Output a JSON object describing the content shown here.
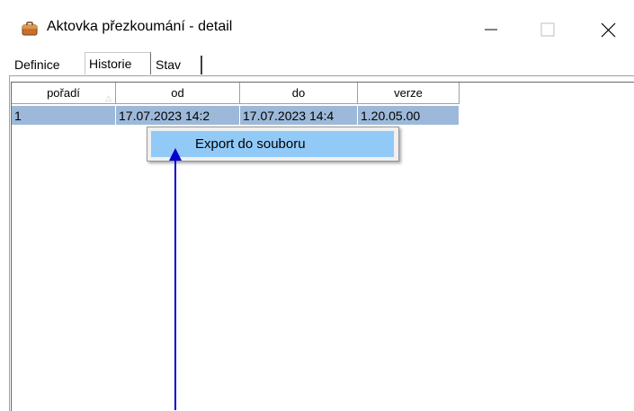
{
  "window": {
    "title": "Aktovka přezkoumání - detail",
    "controls": {
      "minimize": "—",
      "maximize": "☐",
      "close": "✕"
    },
    "app_icon": "briefcase-icon"
  },
  "tabs": [
    {
      "label": "Definice",
      "active": false
    },
    {
      "label": "Historie",
      "active": true
    },
    {
      "label": "Stav",
      "active": false
    }
  ],
  "grid": {
    "columns": [
      "pořadí",
      "od",
      "do",
      "verze"
    ],
    "rows": [
      [
        "1",
        "17.07.2023 14:2",
        "17.07.2023 14:4",
        "1.20.05.00"
      ]
    ],
    "selected_row_color": "#9db9d9"
  },
  "context_menu": {
    "items": [
      {
        "label": "Export do souboru",
        "highlighted": true
      }
    ],
    "highlight_color": "#91c9f7"
  },
  "annotation": {
    "arrow_color": "#0000cc"
  }
}
